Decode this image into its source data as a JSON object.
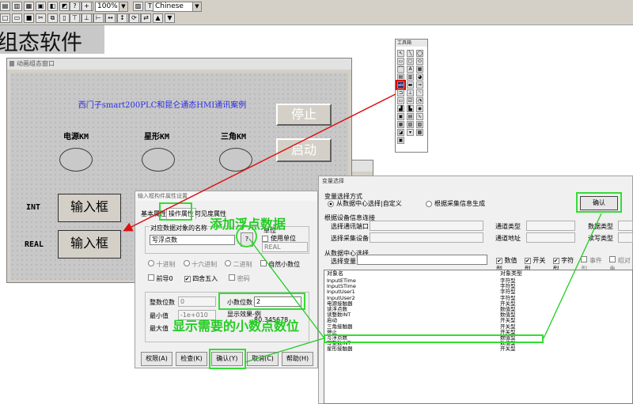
{
  "toolbar": {
    "zoom_value": "100%",
    "language_value": "Chinese"
  },
  "main_title": "组态软件",
  "editor_window": {
    "title": "动画组态窗口",
    "canvas_title": "西门子smart200PLC和昆仑通态HMI通讯案例",
    "stop_button": "停止",
    "start_button": "启动",
    "lamp_labels": [
      "电源KM",
      "星形KM",
      "三角KM"
    ],
    "int_label": "INT",
    "real_label": "REAL",
    "input_box_label": "输入框"
  },
  "toolbox": {
    "title": "工具箱",
    "abl_label": "abl"
  },
  "props_dialog": {
    "title": "输入框构件属性设置",
    "tabs": [
      "基本属性",
      "操作属性",
      "可见度属性"
    ],
    "object_name_label": "对应数据对象的名称",
    "object_name_value": "写浮点数",
    "browse_button": "?",
    "unit_group_label": "单位",
    "use_unit_label": "使用单位",
    "unit_value": "REAL",
    "format_options": [
      "十进制",
      "十六进制",
      "二进制",
      "自然小数位"
    ],
    "prefix_zero": "前导0",
    "round_label": "四舍五入",
    "password_label": "密码",
    "integer_digits_label": "整数位数",
    "integer_digits_value": "0",
    "decimal_digits_label": "小数位数",
    "decimal_digits_value": "2",
    "min_label": "最小值",
    "min_value": "-1e+010",
    "max_label": "最大值",
    "display_effect_label": "显示效果-例",
    "display_effect_value": "80.345678",
    "buttons": [
      "权限(A)",
      "检查(K)",
      "确认(Y)",
      "取消(C)",
      "帮助(H)"
    ]
  },
  "var_dialog": {
    "title": "变量选择",
    "method_label": "变量选择方式",
    "method_opt1": "从数据中心选择|自定义",
    "method_opt2": "根据采集信息生成",
    "confirm_button": "确认",
    "device_group_label": "根据设备信息连接",
    "select_port": "选择通讯端口",
    "channel_type": "通道类型",
    "data_type": "数据类型",
    "select_device": "选择采集设备",
    "channel_addr": "通道地址",
    "rw_type": "读写类型",
    "center_group_label": "从数据中心选择",
    "select_var_label": "选择变量",
    "filters": [
      "数值型",
      "开关型",
      "字符型",
      "事件型",
      "组对象"
    ],
    "filters_checked": [
      true,
      true,
      true,
      false,
      false
    ],
    "list_headers": [
      "对象名",
      "对象类型"
    ],
    "list_rows": [
      [
        "InputETime",
        "字符型"
      ],
      [
        "InputSTime",
        "字符型"
      ],
      [
        "InputUser1",
        "字符型"
      ],
      [
        "InputUser2",
        "字符型"
      ],
      [
        "电源接触器",
        "开关型"
      ],
      [
        "读浮点数",
        "数值型"
      ],
      [
        "读整数INT",
        "数值型"
      ],
      [
        "启动",
        "开关型"
      ],
      [
        "三角接触器",
        "开关型"
      ],
      [
        "停止",
        "开关型"
      ],
      [
        "写浮点数",
        "数值型"
      ],
      [
        "写整数INT",
        "数值型"
      ],
      [
        "星形接触器",
        "开关型"
      ]
    ],
    "highlight_index": 10
  },
  "annotations": {
    "add_float": "添加浮点数据",
    "show_decimals": "显示需要的小数点数位"
  }
}
